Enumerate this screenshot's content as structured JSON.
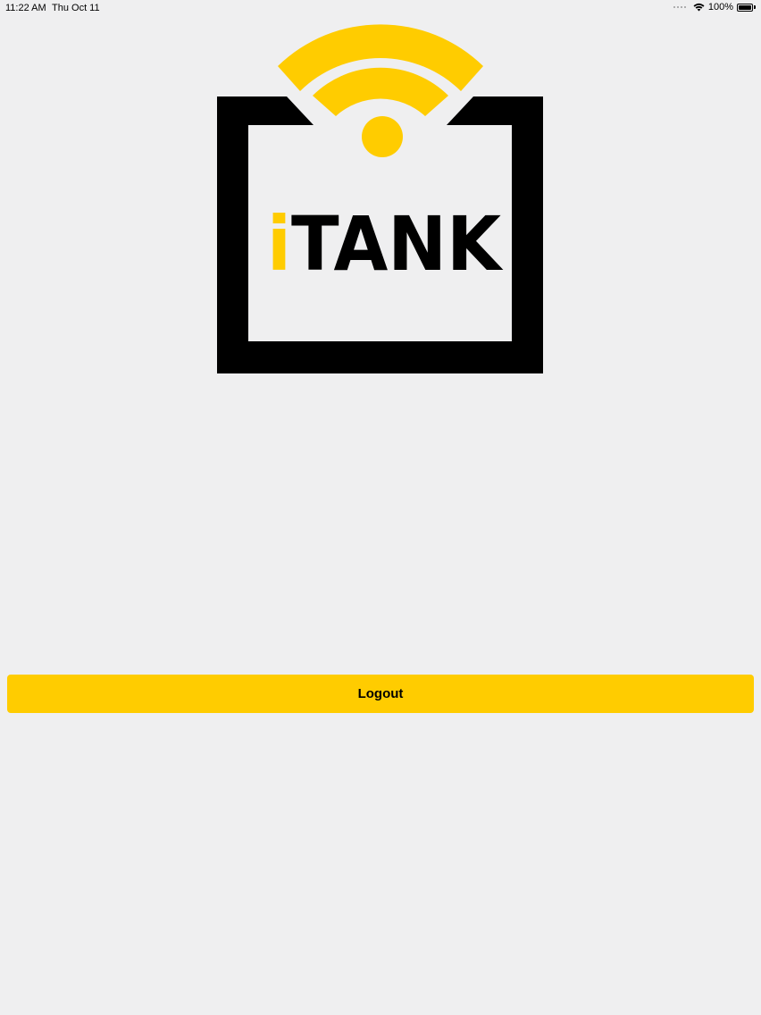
{
  "status_bar": {
    "time": "11:22 AM",
    "date": "Thu Oct 11",
    "battery_text": "100%",
    "battery_level": 1.0,
    "wifi_icon": "wifi-icon",
    "battery_icon": "battery-icon"
  },
  "logo": {
    "text_first_letter": "i",
    "text_rest": "TANK",
    "icon": "itank-wifi-tank-logo",
    "brand_color": "#ffcc00",
    "frame_color": "#000000"
  },
  "actions": {
    "logout_label": "Logout",
    "button_color": "#ffcc00"
  }
}
